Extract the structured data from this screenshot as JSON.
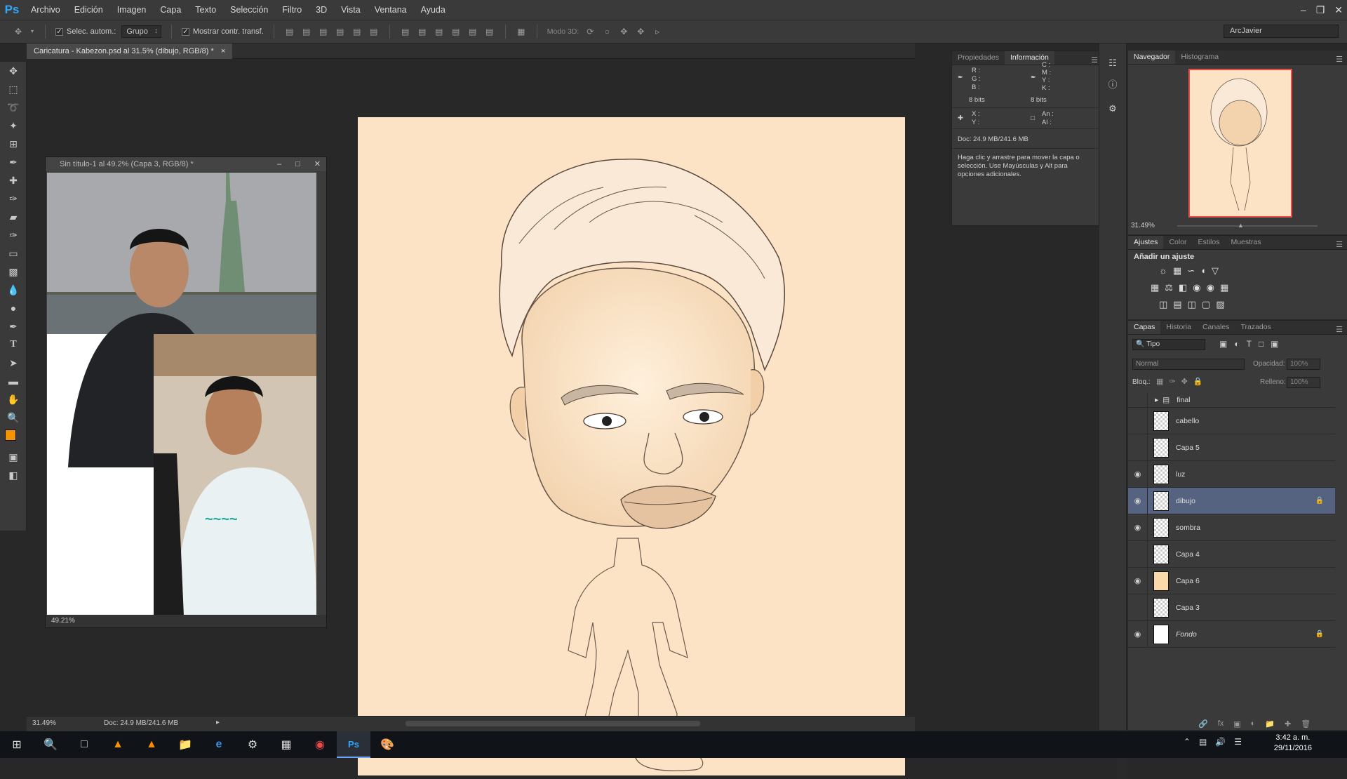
{
  "app": {
    "logo": "Ps"
  },
  "menu": [
    "Archivo",
    "Edición",
    "Imagen",
    "Capa",
    "Texto",
    "Selección",
    "Filtro",
    "3D",
    "Vista",
    "Ventana",
    "Ayuda"
  ],
  "options": {
    "auto_select_label": "Selec. autom.:",
    "auto_select_value": "Grupo",
    "show_transform_label": "Mostrar contr. transf.",
    "mode3d_label": "Modo 3D:",
    "workspace": "ArcJavier"
  },
  "document": {
    "tab_title": "Caricatura - Kabezon.psd al 31.5% (dibujo, RGB/8) *",
    "tab_close": "×",
    "zoom": "31.49%",
    "doc_size": "Doc: 24.9 MB/241.6 MB"
  },
  "float_window": {
    "title": "Sin título-1 al 49.2% (Capa 3, RGB/8) *",
    "zoom": "49.21%"
  },
  "info_panel": {
    "tabs": [
      "Propiedades",
      "Información"
    ],
    "active_tab": "Información",
    "rgb_labels": [
      "R :",
      "G :",
      "B :"
    ],
    "cmyk_labels": [
      "C :",
      "M :",
      "Y :",
      "K :"
    ],
    "bits_left": "8 bits",
    "bits_right": "8 bits",
    "xy_labels": [
      "X :",
      "Y :"
    ],
    "wh_labels": [
      "An :",
      "Al :"
    ],
    "doc_size": "Doc: 24.9 MB/241.6 MB",
    "hint": "Haga clic y arrastre para mover la capa o selección. Use Mayúsculas y Alt para opciones adicionales."
  },
  "navigator": {
    "tabs": [
      "Navegador",
      "Histograma"
    ],
    "zoom": "31.49%"
  },
  "adjustments": {
    "tabs": [
      "Ajustes",
      "Color",
      "Estilos",
      "Muestras"
    ],
    "heading": "Añadir un ajuste"
  },
  "layers": {
    "tabs": [
      "Capas",
      "Historia",
      "Canales",
      "Trazados"
    ],
    "filter_kind": "Tipo",
    "blend_mode": "Normal",
    "opacity_label": "Opacidad:",
    "opacity_value": "100%",
    "lock_label": "Bloq.:",
    "fill_label": "Relleno:",
    "fill_value": "100%",
    "items": [
      {
        "name": "final",
        "visible": false,
        "group": true
      },
      {
        "name": "cabello",
        "visible": false
      },
      {
        "name": "Capa 5",
        "visible": false
      },
      {
        "name": "luz",
        "visible": true
      },
      {
        "name": "dibujo",
        "visible": true,
        "selected": true,
        "locked": true
      },
      {
        "name": "sombra",
        "visible": true
      },
      {
        "name": "Capa 4",
        "visible": false
      },
      {
        "name": "Capa 6",
        "visible": true,
        "thumb_color": "#fcd9a8"
      },
      {
        "name": "Capa 3",
        "visible": false
      },
      {
        "name": "Fondo",
        "visible": true,
        "locked": true,
        "thumb_color": "#ffffff"
      }
    ]
  },
  "taskbar": {
    "time": "3:42 a. m.",
    "date": "29/11/2016"
  }
}
